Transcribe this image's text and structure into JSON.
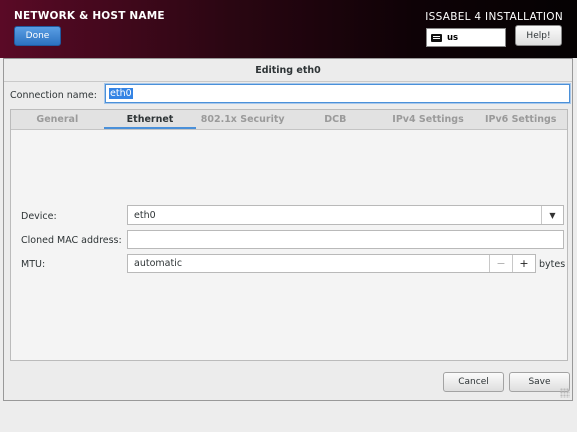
{
  "header": {
    "title": "NETWORK & HOST NAME",
    "done_label": "Done",
    "installation_title": "ISSABEL 4 INSTALLATION",
    "keyboard_layout": "us",
    "help_label": "Help!"
  },
  "dialog": {
    "title": "Editing eth0",
    "connection_name_label": "Connection name:",
    "connection_name_value": "eth0",
    "tabs": [
      {
        "label": "General",
        "active": false
      },
      {
        "label": "Ethernet",
        "active": true
      },
      {
        "label": "802.1x Security",
        "active": false
      },
      {
        "label": "DCB",
        "active": false
      },
      {
        "label": "IPv4 Settings",
        "active": false
      },
      {
        "label": "IPv6 Settings",
        "active": false
      }
    ],
    "device_label": "Device:",
    "device_value": "eth0",
    "cloned_mac_label": "Cloned MAC address:",
    "cloned_mac_value": "",
    "mtu_label": "MTU:",
    "mtu_value": "automatic",
    "mtu_unit": "bytes",
    "cancel_label": "Cancel",
    "save_label": "Save"
  },
  "colors": {
    "accent": "#4a90d9",
    "done_button": "#3a82d0"
  }
}
